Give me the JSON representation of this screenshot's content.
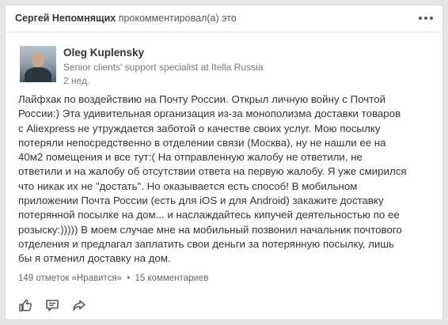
{
  "header": {
    "commenter": "Сергей Непомнящих",
    "action_text": "прокомментировал(а) это",
    "more_icon": "more-horizontal-icon"
  },
  "author": {
    "name": "Oleg Kuplensky",
    "title": "Senior clients' support specialist at Itella Russia",
    "time": "2 нед.",
    "avatar_icon": "person-photo"
  },
  "post": {
    "text": "Лайфхак по воздействию на Почту России. Открыл личную войну с Почтой\nРоссии:)  Эта удивительная организация из-за монополизма доставки товаров\nс Aliexpress не утруждается заботой о качестве своих услуг. Мою посылку\nпотеряли непосредственно в отделении связи (Москва), ну не нашли  ее на\n40м2 помещения и все тут:( На отправленную жалобу не ответили, не\nответили и на жалобу об отсутствии ответа на первую жалобу. Я уже смирился\nчто никак их не \"достать\". Но оказывается есть способ! В мобильном\nприложении Почта России (есть для iOS и для Android) закажите доставку\nпотерянной посылке на дом... и наслаждайтесь кипучей деятельностью по ее\nрозыску:))))) В моем случае мне на мобильный позвонил начальник почтового\nотделения и предлагал заплатить свои деньги за потерянную посылку, лишь\nбы я отменил доставку на дом."
  },
  "social": {
    "likes": "149 отметок «Нравится»",
    "separator": "•",
    "comments": "15 комментариев"
  },
  "actions": {
    "like_icon": "thumbs-up-icon",
    "comment_icon": "comment-icon",
    "share_icon": "share-icon"
  },
  "colors": {
    "page_background": "#e4e5e6",
    "card_background": "#ffffff",
    "icon": "#555555"
  }
}
